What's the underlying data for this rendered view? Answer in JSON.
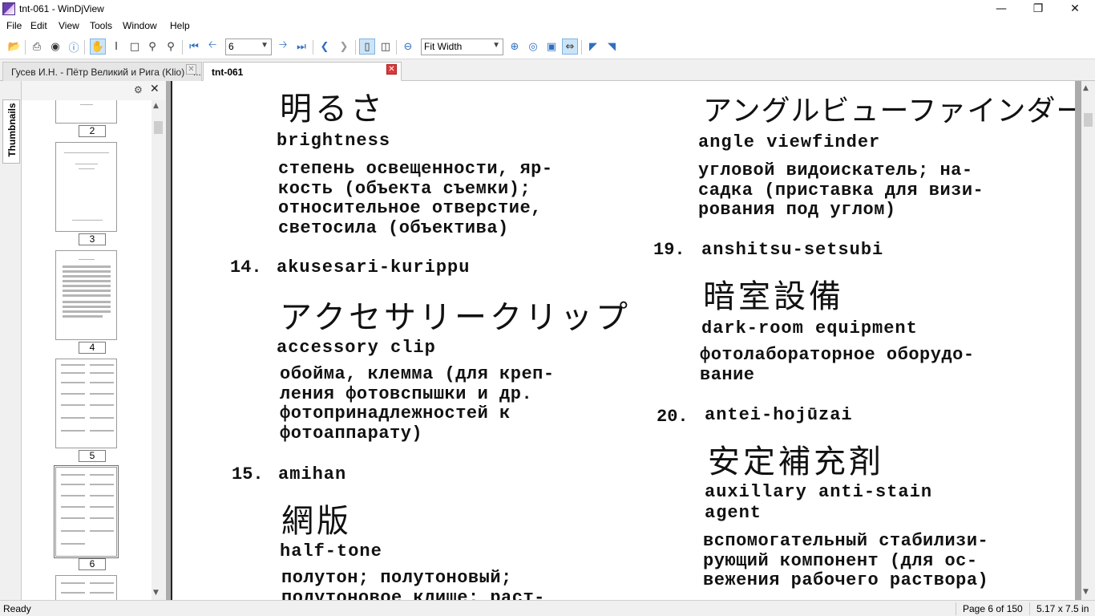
{
  "window": {
    "title": "tnt-061 - WinDjView"
  },
  "menu": [
    "File",
    "Edit",
    "View",
    "Tools",
    "Window",
    "Help"
  ],
  "toolbar": {
    "page_value": "6",
    "zoom_value": "Fit Width"
  },
  "tabs": [
    {
      "label": "Гусев И.Н. - Пётр Великий и Рига (Klio) - ...",
      "active": false
    },
    {
      "label": "tnt-061",
      "active": true
    }
  ],
  "sidebar": {
    "tab_label": "Thumbnails",
    "page_numbers": [
      "2",
      "3",
      "4",
      "5",
      "6"
    ]
  },
  "entries": {
    "e13": {
      "jp": "明るさ",
      "en": "brightness",
      "ru": "степень освещенности, яр-\nкость (объекта съемки);\nотносительное отверстие,\nсветосила (объектива)"
    },
    "e14": {
      "num": "14.",
      "romaji": "akusesari-kurippu",
      "jp": "アクセサリークリップ",
      "en": "accessory clip",
      "ru": "обойма, клемма (для креп-\nления фотовспышки и др.\nфотопринадлежностей к\nфотоаппарату)"
    },
    "e15": {
      "num": "15.",
      "romaji": "amihan",
      "jp": "網版",
      "en": "half-tone",
      "ru": "полутон; полутоновый;\nполутоновое клише; раст-"
    },
    "e18": {
      "jp": "アングルビューファインダー",
      "en": "angle viewfinder",
      "ru": "угловой видоискатель; на-\nсадка (приставка для визи-\nрования под углом)"
    },
    "e19": {
      "num": "19.",
      "romaji": "anshitsu-setsubi",
      "jp": "暗室設備",
      "en": "dark-room equipment",
      "ru": "фотолабораторное оборудо-\nвание"
    },
    "e20": {
      "num": "20.",
      "romaji": "antei-hojūzai",
      "jp": "安定補充剤",
      "en1": "auxillary anti-stain",
      "en2": "agent",
      "ru": "вспомогательный стабилизи-\nрующий компонент (для ос-\nвежения рабочего раствора)"
    }
  },
  "status": {
    "left": "Ready",
    "page": "Page 6 of 150",
    "size": "5.17 x 7.5 in"
  }
}
